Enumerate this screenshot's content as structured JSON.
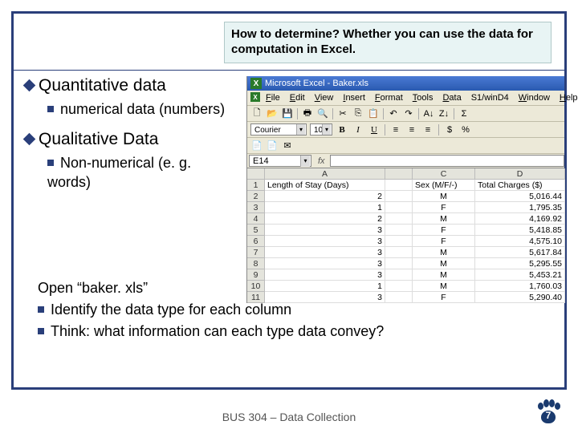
{
  "callout": {
    "text": "How to determine?  Whether you can use the data for computation in Excel."
  },
  "bullets": {
    "quant_title": "Quantitative data",
    "quant_sub": "numerical data (numbers)",
    "qual_title": "Qualitative Data",
    "qual_sub": "Non-numerical (e. g. words)"
  },
  "instructions": {
    "open": "Open “baker. xls”",
    "line1": "Identify the data type for each column",
    "line2": "Think: what information can each type data convey?"
  },
  "footer": {
    "text": "BUS 304 – Data Collection",
    "page": "7"
  },
  "excel": {
    "title": "Microsoft Excel - Baker.xls",
    "menus": [
      "File",
      "Edit",
      "View",
      "Insert",
      "Format",
      "Tools",
      "Data",
      "S1/winD4",
      "Window",
      "Help"
    ],
    "font": "Courier",
    "fontsize": "10",
    "ref": "E14",
    "headers": {
      "A": "A",
      "B": "",
      "C": "C",
      "D": "D"
    },
    "col_labels": {
      "A": "Length of Stay (Days)",
      "C": "Sex (M/F/-)",
      "D": "Total Charges ($)"
    },
    "rows": [
      {
        "n": "2",
        "a": "2",
        "c": "M",
        "d": "5,016.44"
      },
      {
        "n": "3",
        "a": "1",
        "c": "F",
        "d": "1,795.35"
      },
      {
        "n": "4",
        "a": "2",
        "c": "M",
        "d": "4,169.92"
      },
      {
        "n": "5",
        "a": "3",
        "c": "F",
        "d": "5,418.85"
      },
      {
        "n": "6",
        "a": "3",
        "c": "F",
        "d": "4,575.10"
      },
      {
        "n": "7",
        "a": "3",
        "c": "M",
        "d": "5,617.84"
      },
      {
        "n": "8",
        "a": "3",
        "c": "M",
        "d": "5,295.55"
      },
      {
        "n": "9",
        "a": "3",
        "c": "M",
        "d": "5,453.21"
      },
      {
        "n": "10",
        "a": "1",
        "c": "M",
        "d": "1,760.03"
      },
      {
        "n": "11",
        "a": "3",
        "c": "F",
        "d": "5,290.40"
      }
    ]
  }
}
